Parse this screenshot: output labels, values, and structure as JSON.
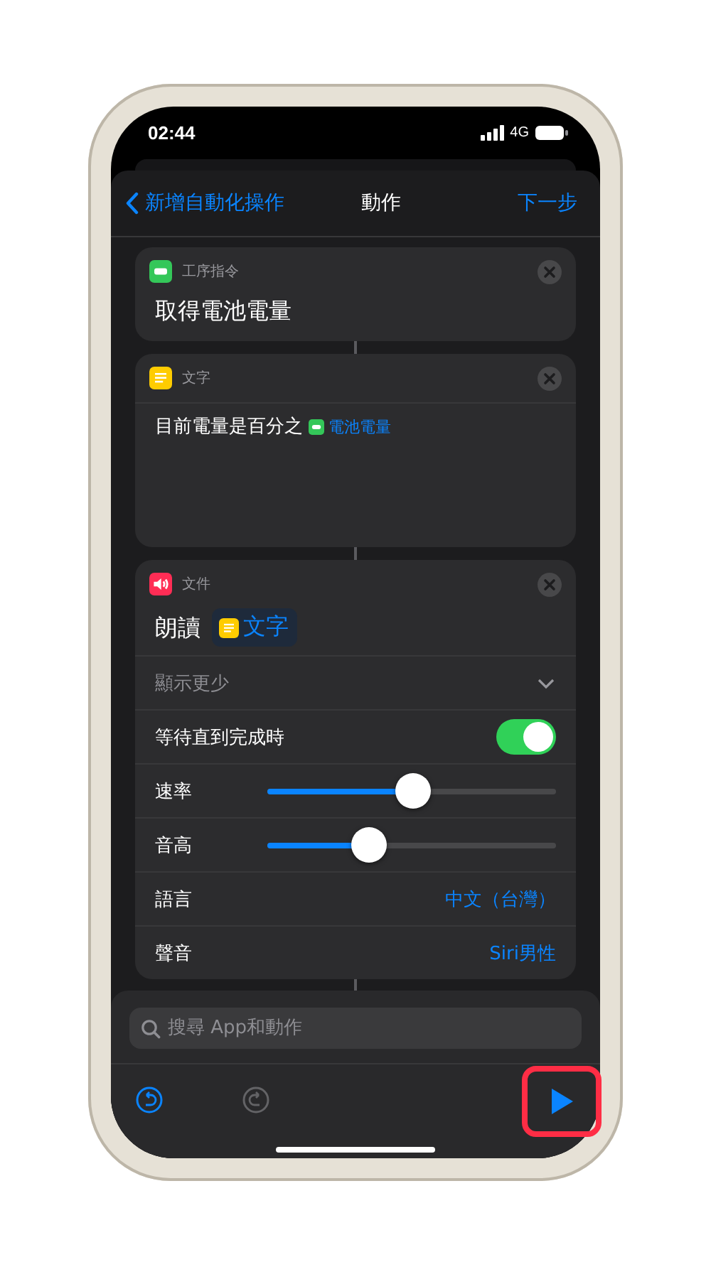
{
  "status_bar": {
    "time": "02:44",
    "network": "4G"
  },
  "nav": {
    "back": "新增自動化操作",
    "title": "動作",
    "next": "下一步"
  },
  "actions": [
    {
      "kind": "battery",
      "color": "#34c759",
      "category": "工序指令",
      "title": "取得電池電量"
    },
    {
      "kind": "text",
      "color": "#ffcc00",
      "category": "文字",
      "text": "目前電量是百分之",
      "variable": {
        "kind": "battery",
        "label": "電池電量"
      }
    },
    {
      "kind": "speaker",
      "color": "#ff2d55",
      "category": "文件",
      "title": "朗讀",
      "variable": {
        "kind": "text",
        "label": "文字"
      },
      "options": [
        {
          "kind": "disclosure",
          "label": "顯示更少",
          "expanded": true
        },
        {
          "kind": "toggle",
          "label": "等待直到完成時",
          "on": true
        },
        {
          "kind": "slider",
          "label": "速率",
          "level": 0.5
        },
        {
          "kind": "slider",
          "label": "音高",
          "level": 0.35
        },
        {
          "kind": "value",
          "label": "語言",
          "value": "中文（台灣）"
        },
        {
          "kind": "value",
          "label": "聲音",
          "value": "Siri男性"
        }
      ]
    }
  ],
  "search": {
    "placeholder": "搜尋 App和動作"
  },
  "toolbar": [
    {
      "kind": "undo",
      "disabled": false
    },
    {
      "kind": "redo",
      "disabled": true
    },
    {
      "kind": "run",
      "disabled": false,
      "highlighted": true
    }
  ]
}
